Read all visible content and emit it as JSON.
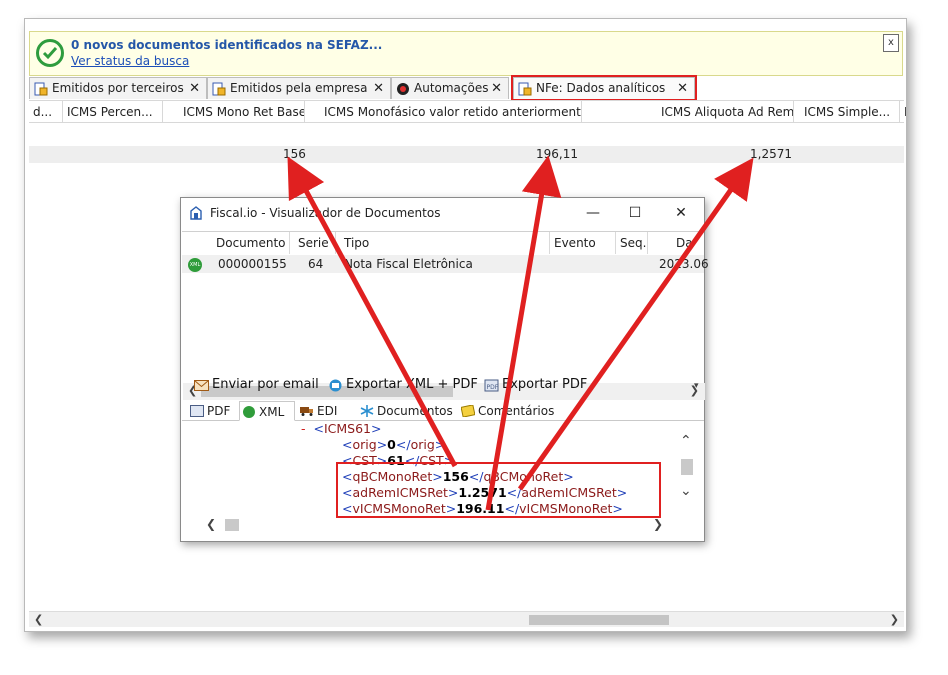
{
  "notification": {
    "message": "0 novos documentos identificados na SEFAZ...",
    "link": "Ver status da busca",
    "close": "x"
  },
  "tabs": [
    {
      "label": "Emitidos por terceiros",
      "close": "✕"
    },
    {
      "label": "Emitidos pela empresa",
      "close": "✕"
    },
    {
      "label": "Automações",
      "close": "✕"
    },
    {
      "label": "NFe: Dados analíticos",
      "close": "✕"
    }
  ],
  "grid": {
    "columns": [
      "d...",
      "ICMS Percen...",
      "ICMS Mono Ret Base",
      "ICMS Monofásico valor retido anteriormente",
      "ICMS Aliquota Ad Rem",
      "ICMS Simple...",
      "I"
    ],
    "row": {
      "mono_ret_base": "156",
      "monofasico_valor": "196,11",
      "aliquota_ad_rem": "1,2571"
    }
  },
  "viewer": {
    "title": "Fiscal.io - Visualizador de Documentos",
    "minimize": "—",
    "maximize": "☐",
    "close": "✕",
    "columns": [
      "Documento",
      "Serie",
      "Tipo",
      "Evento",
      "Seq.",
      "Da"
    ],
    "row": {
      "badge": "XML",
      "documento": "000000155",
      "serie": "64",
      "tipo": "Nota Fiscal Eletrônica",
      "data": "2023.06"
    },
    "toolbar": {
      "email": "Enviar por email",
      "export_xml_pdf": "Exportar XML + PDF",
      "export_pdf": "Exportar PDF"
    },
    "tabs": [
      "PDF",
      "XML",
      "EDI",
      "Documentos",
      "Comentários"
    ],
    "xml": {
      "dash": "-",
      "lines": [
        {
          "open": "ICMS61",
          "value": "",
          "close": ""
        },
        {
          "open": "orig",
          "value": "0",
          "close": "orig"
        },
        {
          "open": "CST",
          "value": "61",
          "close": "CST"
        },
        {
          "open": "qBCMonoRet",
          "value": "156",
          "close": "qBCMonoRet"
        },
        {
          "open": "adRemICMSRet",
          "value": "1.2571",
          "close": "adRemICMSRet"
        },
        {
          "open": "vICMSMonoRet",
          "value": "196.11",
          "close": "vICMSMonoRet"
        }
      ]
    }
  },
  "colors": {
    "highlight": "#e02020",
    "link": "#1d4fb8",
    "notif_bg": "#ffffe6",
    "success": "#2e9c3e"
  }
}
